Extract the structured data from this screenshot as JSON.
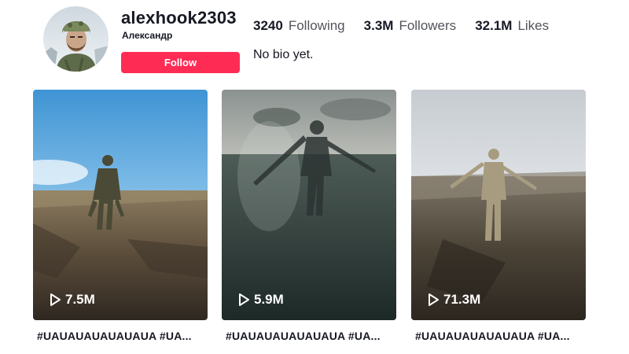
{
  "profile": {
    "username": "alexhook2303",
    "nickname": "Александр",
    "follow_label": "Follow",
    "bio": "No bio yet.",
    "accent_color": "#fe2c55"
  },
  "stats": [
    {
      "value": "3240",
      "label": "Following"
    },
    {
      "value": "3.3M",
      "label": "Followers"
    },
    {
      "value": "32.1M",
      "label": "Likes"
    }
  ],
  "videos": [
    {
      "views": "7.5M",
      "caption": "#UAUAUAUAUAUAUA #UA...",
      "icon": "play-icon"
    },
    {
      "views": "5.9M",
      "caption": "#UAUAUAUAUAUAUA #UA...",
      "icon": "play-icon"
    },
    {
      "views": "71.3M",
      "caption": "#UAUAUAUAUAUAUA #UA...",
      "icon": "play-icon"
    }
  ]
}
